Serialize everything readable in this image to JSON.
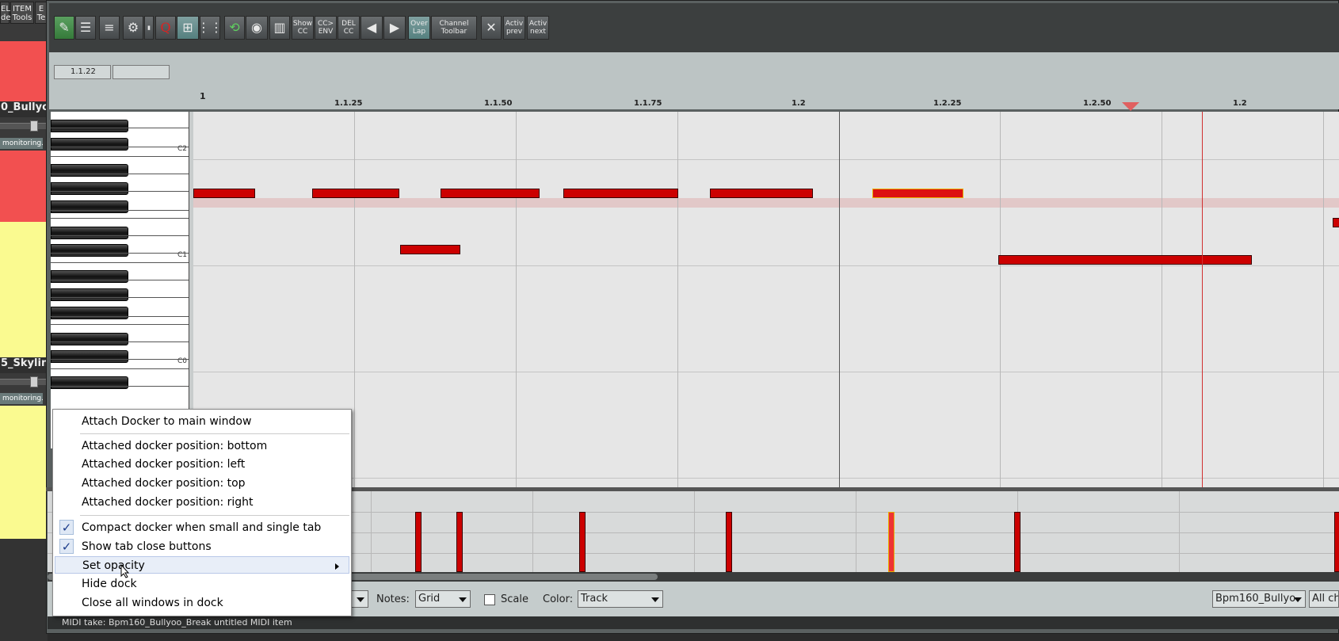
{
  "left_panel": {
    "tabs": [
      "EL\nde",
      "ITEM\nTools",
      "E\nTe"
    ],
    "track1_name": "0_Bullyo",
    "track2_name": "5_Skylin",
    "monitoring_label": "monitoring.",
    "colors": {
      "red_track": "#f25050",
      "yellow_track": "#fafa90"
    }
  },
  "toolbar": {
    "buttons": [
      {
        "id": "show-cc",
        "label": "Show\nCC"
      },
      {
        "id": "cc-env",
        "label": "CC>\nENV"
      },
      {
        "id": "del-cc",
        "label": "DEL\nCC"
      },
      {
        "id": "overlap",
        "label": "Over\nLap"
      },
      {
        "id": "channel-toolbar",
        "label": "Channel\nToolbar"
      },
      {
        "id": "activ-prev",
        "label": "Activ\nprev"
      },
      {
        "id": "activ-next",
        "label": "Activ\nnext"
      }
    ],
    "q_glyph": "Q"
  },
  "info": {
    "position": "1.1.22",
    "length": ""
  },
  "ruler": {
    "start_label": "1",
    "labels": [
      "1.1.25",
      "1.1.50",
      "1.1.75",
      "1.2",
      "1.2.25",
      "1.2.50",
      "1.2"
    ]
  },
  "piano": {
    "labels": [
      "C2",
      "C1",
      "C0"
    ]
  },
  "context_menu": {
    "items": [
      {
        "label": "Attach Docker to main window"
      },
      {
        "label": "Attached docker position: bottom"
      },
      {
        "label": "Attached docker position: left"
      },
      {
        "label": "Attached docker position: top"
      },
      {
        "label": "Attached docker position: right"
      },
      {
        "label": "Compact docker when small and single tab",
        "checked": true
      },
      {
        "label": "Show tab close buttons",
        "checked": true
      },
      {
        "label": "Set opacity",
        "submenu": true
      },
      {
        "label": "Hide dock"
      },
      {
        "label": "Close all windows in dock"
      }
    ],
    "check_glyph": "✓"
  },
  "bottom_bar": {
    "notes_label": "Notes:",
    "notes_value": "Grid",
    "scale_label": "Scale",
    "color_label": "Color:",
    "color_value": "Track",
    "take_value": "Bpm160_Bullyo",
    "channel_value": "All cha"
  },
  "status": {
    "text": "MIDI take: Bpm160_Bullyoo_Break untitled MIDI item"
  },
  "colors": {
    "note": "#cc0000",
    "selected_note_border": "#e8b000",
    "playhead": "#d03030"
  }
}
